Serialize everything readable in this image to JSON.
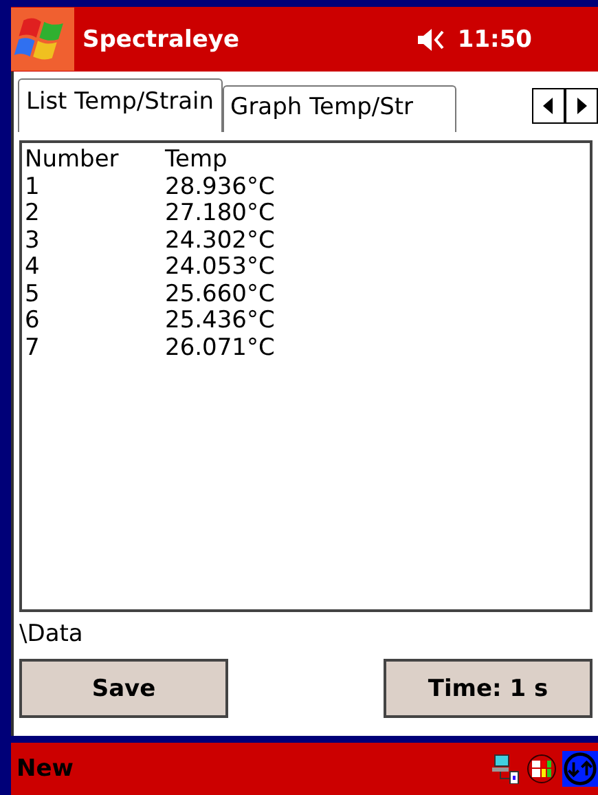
{
  "title_bar": {
    "title": "Spectraleye",
    "time": "11:50"
  },
  "tabs": [
    {
      "label": "List Temp/Strain",
      "selected": true
    },
    {
      "label": "Graph Temp/Str",
      "selected": false
    }
  ],
  "table": {
    "columns": [
      "Number",
      "Temp"
    ],
    "rows": [
      [
        "1",
        "28.936°C"
      ],
      [
        "2",
        "27.180°C"
      ],
      [
        "3",
        "24.302°C"
      ],
      [
        "4",
        "24.053°C"
      ],
      [
        "5",
        "25.660°C"
      ],
      [
        "6",
        "25.436°C"
      ],
      [
        "7",
        "26.071°C"
      ]
    ]
  },
  "path": "\\Data",
  "buttons": [
    "Save",
    "Time: 1 s"
  ],
  "menu_bar": {
    "label": "New"
  }
}
